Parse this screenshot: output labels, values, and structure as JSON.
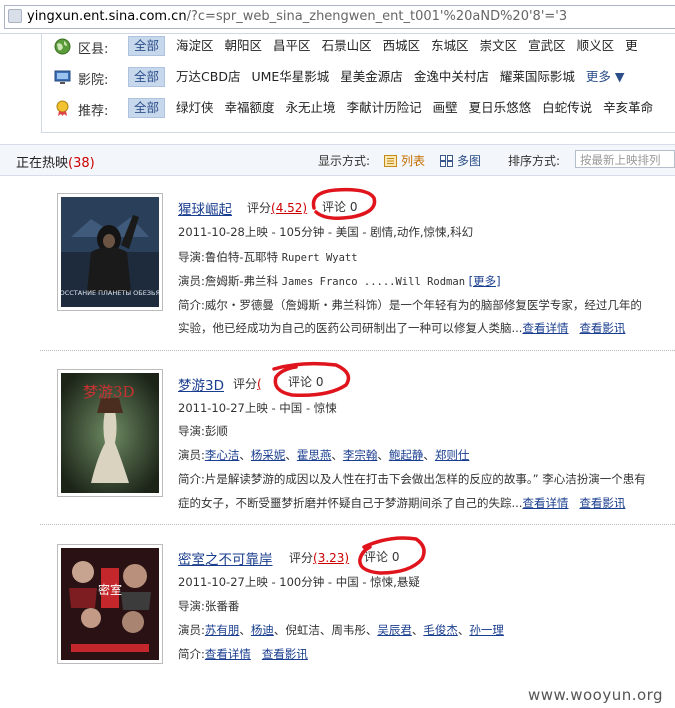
{
  "address_bar": {
    "host": "yingxun.ent.sina.com.cn",
    "path": "/?c=spr_web_sina_zhengwen_ent_t001'%20aND%20'8'='3"
  },
  "filters": {
    "district": {
      "label": "区县:",
      "icon": "globe-icon",
      "items": [
        "全部",
        "海淀区",
        "朝阳区",
        "昌平区",
        "石景山区",
        "西城区",
        "东城区",
        "崇文区",
        "宣武区",
        "顺义区",
        "更"
      ]
    },
    "cinema": {
      "label": "影院:",
      "icon": "monitor-icon",
      "items": [
        "全部",
        "万达CBD店",
        "UME华星影城",
        "星美金源店",
        "金逸中关村店",
        "耀莱国际影城"
      ],
      "more": "更多 ▼"
    },
    "recommend": {
      "label": "推荐:",
      "icon": "award-icon",
      "items": [
        "全部",
        "绿灯侠",
        "幸福额度",
        "永无止境",
        "李献计历险记",
        "画壁",
        "夏日乐悠悠",
        "白蛇传说",
        "辛亥革命"
      ]
    }
  },
  "list_header": {
    "title": "正在热映",
    "count": "(38)",
    "display_mode_label": "显示方式:",
    "list_label": "列表",
    "grid_label": "多图",
    "sort_label": "排序方式:",
    "sort_value": "按最新上映排列"
  },
  "movies": [
    {
      "title": "猩球崛起",
      "rating_label": "评分",
      "rating": "(4.52)",
      "comment": "评论 0",
      "meta": "2011-10-28上映 - 105分钟 - 美国 - 剧情,动作,惊悚,科幻",
      "director_label": "导演:",
      "director": "鲁伯特-瓦耶特",
      "director_en": "Rupert Wyatt",
      "cast_label": "演员:",
      "cast": "詹姆斯-弗兰科",
      "cast_en": "James Franco .....Will Rodman",
      "cast_more": "[更多]",
      "summary_label": "简介:",
      "summary1": "威尔・罗德曼（詹姆斯・弗兰科饰）是一个年轻有为的脑部修复医学专家，经过几年的",
      "summary2": "实验，他已经成功为自己的医药公司研制出了一种可以修复人类脑...",
      "details_link": "查看详情",
      "news_link": "查看影讯",
      "poster_text": "ВОССТАНИЕ ПЛАНЕТЫ ОБЕЗЬЯН"
    },
    {
      "title": "梦游3D",
      "rating_label": "评分",
      "rating": "(",
      "comment": "评论 0",
      "meta": "2011-10-27上映 - 中国 - 惊悚",
      "director_label": "导演:",
      "director": "彭顺",
      "cast_label": "演员:",
      "cast_links": [
        "李心洁",
        "杨采妮",
        "霍思燕",
        "李宗翰",
        "鲍起静",
        "郑则仕"
      ],
      "summary_label": "简介:",
      "summary1": "片是解读梦游的成因以及人性在打击下会做出怎样的反应的故事。” 李心洁扮演一个患有",
      "summary2": "症的女子，不断受噩梦折磨并怀疑自己于梦游期间杀了自己的失踪...",
      "details_link": "查看详情",
      "news_link": "查看影讯",
      "poster_text": "梦游3D"
    },
    {
      "title": "密室之不可靠岸",
      "rating_label": "评分",
      "rating": "(3.23)",
      "comment": "评论 0",
      "meta": "2011-10-27上映 - 100分钟 - 中国 - 惊悚,悬疑",
      "director_label": "导演:",
      "director": "张番番",
      "cast_label": "演员:",
      "cast_mixed": [
        {
          "name": "苏有朋",
          "link": true
        },
        {
          "name": "杨迪",
          "link": true
        },
        {
          "name": "倪虹洁",
          "link": false
        },
        {
          "name": "周韦彤",
          "link": false
        },
        {
          "name": "吴辰君",
          "link": true
        },
        {
          "name": "毛俊杰",
          "link": true
        },
        {
          "name": "孙一理",
          "link": true
        }
      ],
      "summary_label": "简介:",
      "details_link": "查看详情",
      "news_link": "查看影讯",
      "poster_text": "密室"
    }
  ],
  "watermark": "www.wooyun.org",
  "colors": {
    "annotation": "#e0141c",
    "link": "#1a3e8f",
    "rating": "#cc0000"
  }
}
